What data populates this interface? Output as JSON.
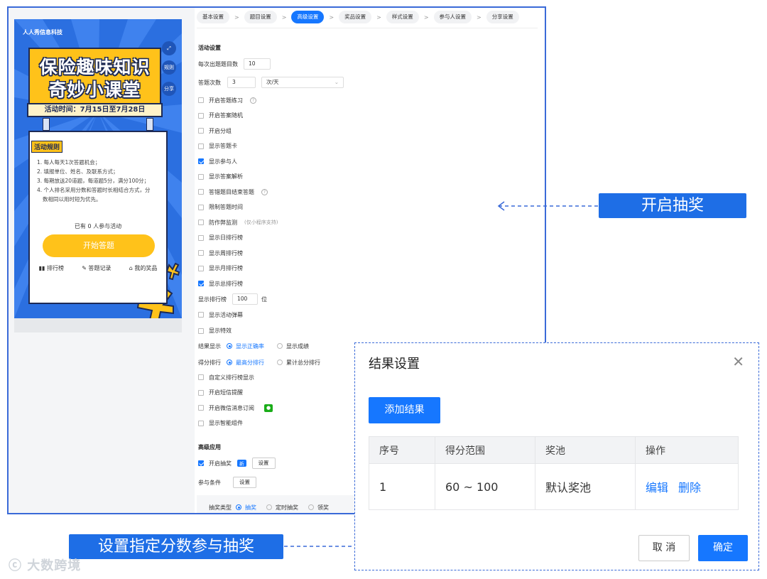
{
  "poster": {
    "company": "人人秀信息科技",
    "title_line1": "保险趣味知识",
    "title_line2": "奇妙小课堂",
    "date": "活动时间：7月15日至7月28日",
    "side_rules": "规则",
    "side_share": "分享",
    "rules_tag": "活动规则",
    "rules": [
      "1. 每人每天1次答题机会；",
      "2. 填报单位、姓名、及联系方式；",
      "3. 每期放送20道题，每道题5分，满分100分；",
      "4. 个人排名采用分数和答题时长相结合方式，分",
      "   数相同以用时短为优先。"
    ],
    "participants": "已有 0 人参与活动",
    "start_button": "开始答题",
    "links": [
      "排行榜",
      "答题记录",
      "我的奖品"
    ]
  },
  "tabs": [
    "基本设置",
    "题目设置",
    "高级设置",
    "奖品设置",
    "样式设置",
    "参与人设置",
    "分享设置"
  ],
  "tab_separator": ">",
  "settings": {
    "section_activity": "活动设置",
    "questions_label": "每次出题题目数",
    "questions_value": "10",
    "answers_label": "答题次数",
    "answers_value": "3",
    "answers_unit": "次/天",
    "options": [
      {
        "label": "开启答题练习",
        "checked": false,
        "help": true
      },
      {
        "label": "开启答案随机",
        "checked": false
      },
      {
        "label": "开启分组",
        "checked": false
      },
      {
        "label": "显示答题卡",
        "checked": false
      },
      {
        "label": "显示参与人",
        "checked": true
      },
      {
        "label": "显示答案解析",
        "checked": false
      },
      {
        "label": "答错题目结束答题",
        "checked": false,
        "help": true
      },
      {
        "label": "限制答题时间",
        "checked": false
      },
      {
        "label": "防作弊监测",
        "checked": false,
        "hint": "(仅小程序支持)"
      },
      {
        "label": "显示日排行榜",
        "checked": false
      },
      {
        "label": "显示周排行榜",
        "checked": false
      },
      {
        "label": "显示月排行榜",
        "checked": false
      },
      {
        "label": "显示总排行榜",
        "checked": true
      }
    ],
    "rank_label": "显示排行榜",
    "rank_value": "100",
    "rank_unit": "位",
    "options2": [
      {
        "label": "显示活动弹幕",
        "checked": false
      },
      {
        "label": "显示特效",
        "checked": false
      }
    ],
    "result_label": "结果显示",
    "result_opt1": "显示正确率",
    "result_opt2": "显示成绩",
    "score_label": "得分排行",
    "score_opt1": "最高分排行",
    "score_opt2": "累计总分排行",
    "options3": [
      {
        "label": "自定义排行榜显示",
        "checked": false
      },
      {
        "label": "开启短信提醒",
        "checked": false
      },
      {
        "label": "开启微信消息订阅",
        "checked": false,
        "wechat": true
      },
      {
        "label": "显示智能组件",
        "checked": false
      }
    ],
    "section_advanced": "高级应用",
    "lottery_label": "开启抽奖",
    "lottery_badge": "新",
    "lottery_setting": "设置",
    "condition_label": "参与条件",
    "condition_setting": "设置",
    "lottery_type_label": "抽奖类型",
    "lottery_type_opt1": "抽奖",
    "lottery_type_opt2": "定时抽奖",
    "lottery_type_opt3": "领奖"
  },
  "callouts": {
    "lottery": "开启抽奖",
    "score": "设置指定分数参与抽奖"
  },
  "watermark": "大数跨境",
  "dialog": {
    "title": "结果设置",
    "add_button": "添加结果",
    "columns": [
      "序号",
      "得分范围",
      "奖池",
      "操作"
    ],
    "rows": [
      {
        "index": "1",
        "range": "60 ~ 100",
        "pool": "默认奖池",
        "edit": "编辑",
        "delete": "删除"
      }
    ],
    "cancel": "取 消",
    "confirm": "确定"
  }
}
